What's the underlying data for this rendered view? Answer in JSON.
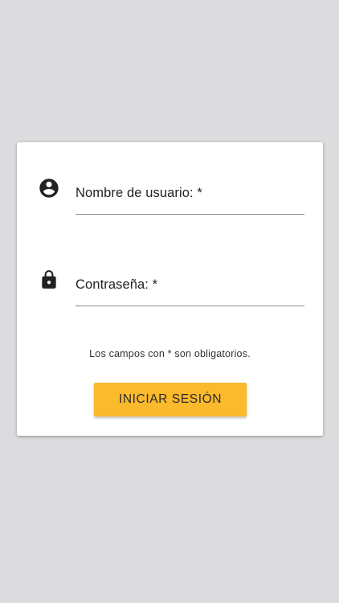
{
  "colors": {
    "background": "#dcdcde",
    "card": "#ffffff",
    "button": "#fbb92c",
    "icon": "#222222",
    "underline": "#8a8a8a"
  },
  "form": {
    "username": {
      "icon": "account-circle-icon",
      "label": "Nombre de usuario: *",
      "value": ""
    },
    "password": {
      "icon": "lock-icon",
      "label": "Contraseña: *",
      "value": ""
    },
    "required_note": "Los campos con * son obligatorios.",
    "submit_label": "INICIAR SESIÓN"
  }
}
